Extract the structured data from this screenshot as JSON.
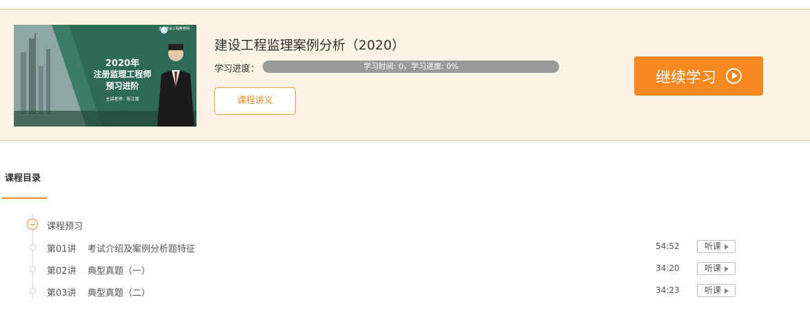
{
  "course": {
    "title": "建设工程监理案例分析（2020）",
    "progress_label": "学习进度：",
    "progress_text": "学习时间: 0，学习进度: 0%",
    "progress_fraction": 0,
    "notes_button": "课程讲义",
    "continue_button": "继续学习",
    "thumbnail": {
      "year": "2020年",
      "line1": "注册监理工程师",
      "line2": "预习进阶",
      "teacher": "主讲老师：陈江潮",
      "logo": "正保建设工程教育网"
    }
  },
  "catalog": {
    "heading": "课程目录",
    "chapter": "课程预习",
    "listen_label": "听课",
    "lessons": [
      {
        "num": "第01讲",
        "name": "考试介绍及案例分析题特征",
        "duration": "54:52"
      },
      {
        "num": "第02讲",
        "name": "典型真题（一）",
        "duration": "34:20"
      },
      {
        "num": "第03讲",
        "name": "典型真题（二）",
        "duration": "34:23"
      }
    ]
  },
  "colors": {
    "accent": "#f5881e",
    "banner_bg": "#fdf3e4",
    "progress_track": "#9a9a9a"
  },
  "icons": [
    "play-icon",
    "collapse-icon",
    "timeline-dot-icon",
    "triangle-right-icon"
  ]
}
